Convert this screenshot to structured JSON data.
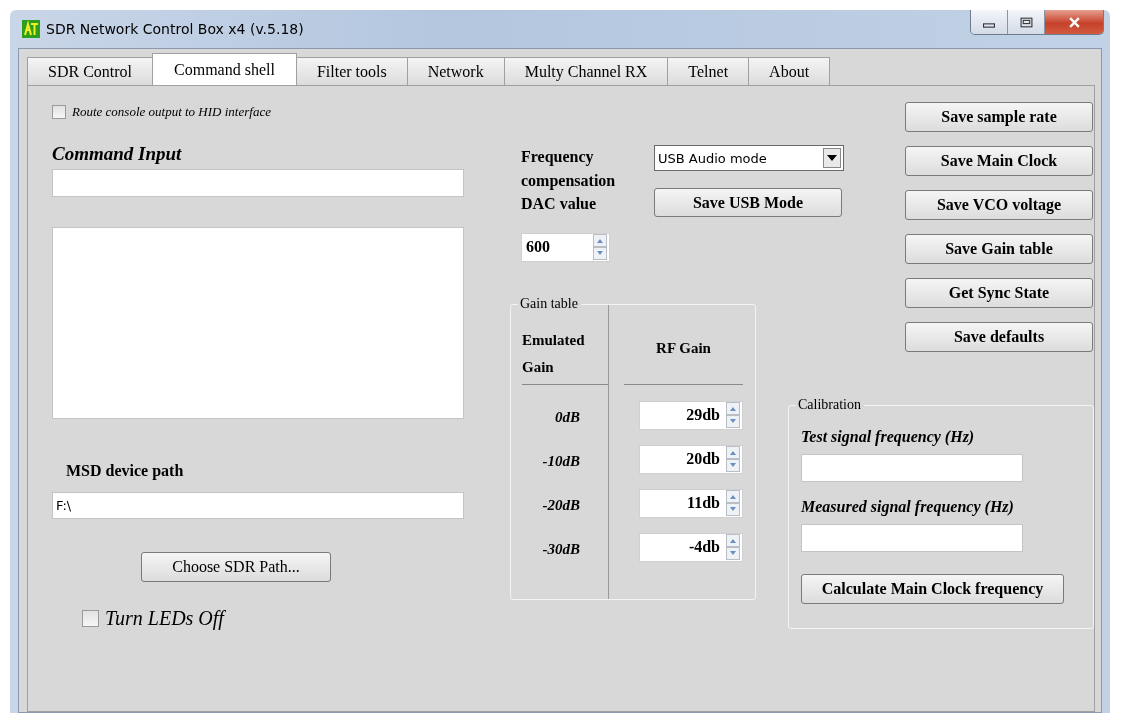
{
  "window": {
    "title": "SDR Network Control Box x4 (v.5.18)"
  },
  "tabs": [
    {
      "label": "SDR Control",
      "selected": false
    },
    {
      "label": "Command shell",
      "selected": true
    },
    {
      "label": "Filter tools",
      "selected": false
    },
    {
      "label": "Network",
      "selected": false
    },
    {
      "label": "Multy Channel RX",
      "selected": false
    },
    {
      "label": "Telnet",
      "selected": false
    },
    {
      "label": "About",
      "selected": false
    }
  ],
  "route_console": {
    "label": "Route console output to HID interface",
    "checked": false
  },
  "command_input": {
    "label": "Command Input"
  },
  "msd_device_path": {
    "label": "MSD device path",
    "value": "F:\\"
  },
  "choose_path_button": "Choose SDR Path...",
  "turn_leds_off": {
    "label": "Turn LEDs Off",
    "checked": false
  },
  "frequency_compensation": {
    "label": "Frequency compensation DAC value",
    "value": "600"
  },
  "usb_mode": {
    "value": "USB Audio mode",
    "button": "Save USB Mode"
  },
  "gain_table": {
    "title": "Gain table",
    "columns": [
      "Emulated Gain",
      "RF Gain"
    ],
    "rows": [
      {
        "emulated": "0dB",
        "rf_gain": "29db"
      },
      {
        "emulated": "-10dB",
        "rf_gain": "20db"
      },
      {
        "emulated": "-20dB",
        "rf_gain": "11db"
      },
      {
        "emulated": "-30dB",
        "rf_gain": "-4db"
      }
    ]
  },
  "action_buttons": [
    "Save sample rate",
    "Save Main Clock",
    "Save VCO voltage",
    "Save Gain table",
    "Get Sync State",
    "Save defaults"
  ],
  "calibration": {
    "title": "Calibration",
    "fields": [
      {
        "label": "Test signal frequency (Hz)"
      },
      {
        "label": "Measured signal frequency (Hz)"
      }
    ],
    "button": "Calculate Main Clock frequency"
  }
}
